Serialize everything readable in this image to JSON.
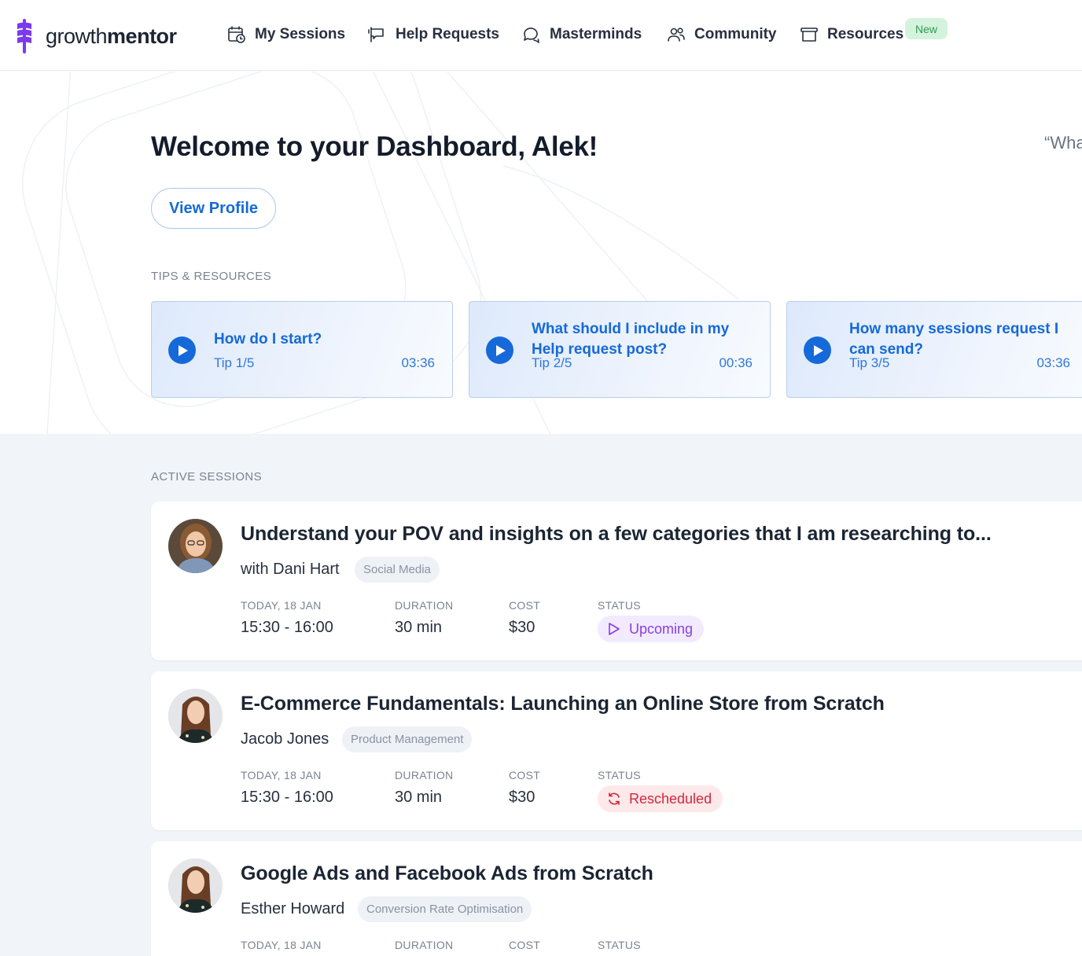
{
  "brand": {
    "name_regular": "growth",
    "name_bold": "mentor",
    "accent_color": "#7c3aed",
    "primary_color": "#1669d8"
  },
  "nav": {
    "items": [
      {
        "label": "My Sessions",
        "icon": "calendar-clock-icon"
      },
      {
        "label": "Help Requests",
        "icon": "flag-message-icon"
      },
      {
        "label": "Masterminds",
        "icon": "chat-bubbles-icon"
      },
      {
        "label": "Community",
        "icon": "users-icon"
      },
      {
        "label": "Resources",
        "icon": "archive-box-icon"
      }
    ],
    "new_badge": "New"
  },
  "hero": {
    "welcome": "Welcome to your Dashboard, Alek!",
    "quote_fragment": "“Wha",
    "view_profile": "View Profile",
    "tips_label": "TIPS & RESOURCES",
    "tips": [
      {
        "title": "How do I start?",
        "number": "Tip 1/5",
        "duration": "03:36"
      },
      {
        "title": "What should I include in my Help request post?",
        "number": "Tip 2/5",
        "duration": "00:36"
      },
      {
        "title": "How many sessions request I can send?",
        "number": "Tip 3/5",
        "duration": "03:36"
      }
    ]
  },
  "sessions": {
    "label": "ACTIVE SESSIONS",
    "meta_labels": {
      "date": "TODAY, 18 JAN",
      "duration": "DURATION",
      "cost": "COST",
      "status": "STATUS"
    },
    "items": [
      {
        "title": "Understand your POV and insights on a few categories that I am researching to...",
        "mentor": "with Dani Hart",
        "tag": "Social Media",
        "time": "15:30 - 16:00",
        "duration": "30 min",
        "cost": "$30",
        "status": "Upcoming",
        "status_color": "#8a3fe0"
      },
      {
        "title": "E-Commerce Fundamentals: Launching an Online Store from Scratch",
        "mentor": "Jacob Jones",
        "tag": "Product Management",
        "time": "15:30 - 16:00",
        "duration": "30 min",
        "cost": "$30",
        "status": "Rescheduled",
        "status_color": "#d1293b"
      },
      {
        "title": "Google Ads and Facebook Ads from Scratch",
        "mentor": "Esther Howard",
        "tag": "Conversion Rate Optimisation"
      }
    ]
  }
}
